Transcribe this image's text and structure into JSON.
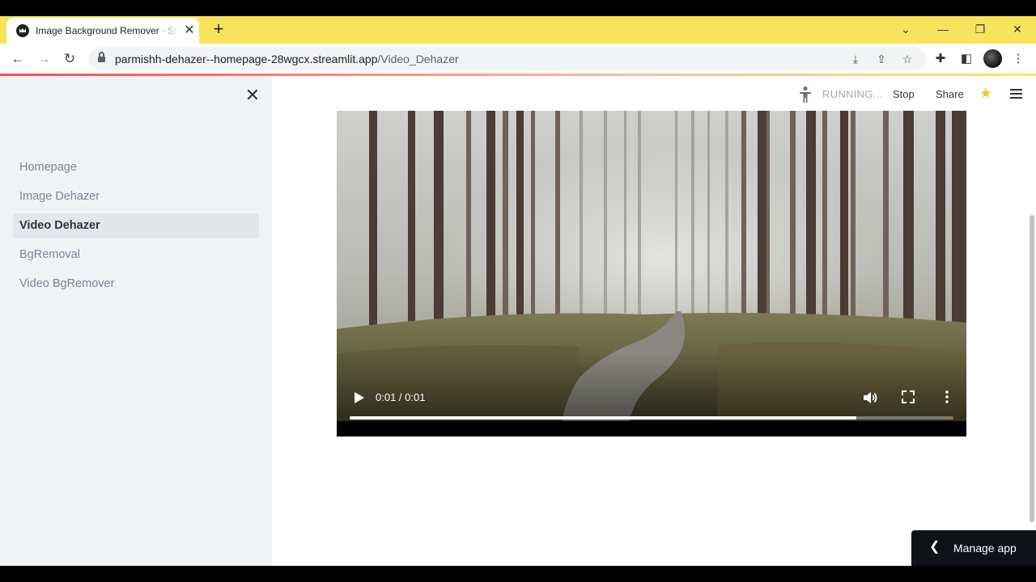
{
  "browser": {
    "tab": {
      "title": "Image Background Remover · Streamlit"
    },
    "address": {
      "host": "parmishh-dehazer--homepage-28wgcx.streamlit.app",
      "path": "/Video_Dehazer"
    }
  },
  "sidebar": {
    "items": [
      {
        "label": "Homepage",
        "active": false
      },
      {
        "label": "Image Dehazer",
        "active": false
      },
      {
        "label": "Video Dehazer",
        "active": true
      },
      {
        "label": "BgRemoval",
        "active": false
      },
      {
        "label": "Video BgRemover",
        "active": false
      }
    ]
  },
  "header": {
    "status": "RUNNING...",
    "stop_label": "Stop",
    "share_label": "Share"
  },
  "video": {
    "time": "0:01 / 0:01",
    "progress": 0.839
  },
  "manage_app": {
    "label": "Manage app"
  },
  "colors": {
    "tab_bar": "#f9e35a",
    "sidebar_bg": "#f0f2f6",
    "active_nav_bg": "#e4e6ec",
    "star": "#f5c518",
    "manage_app_bg": "#0e1117"
  }
}
